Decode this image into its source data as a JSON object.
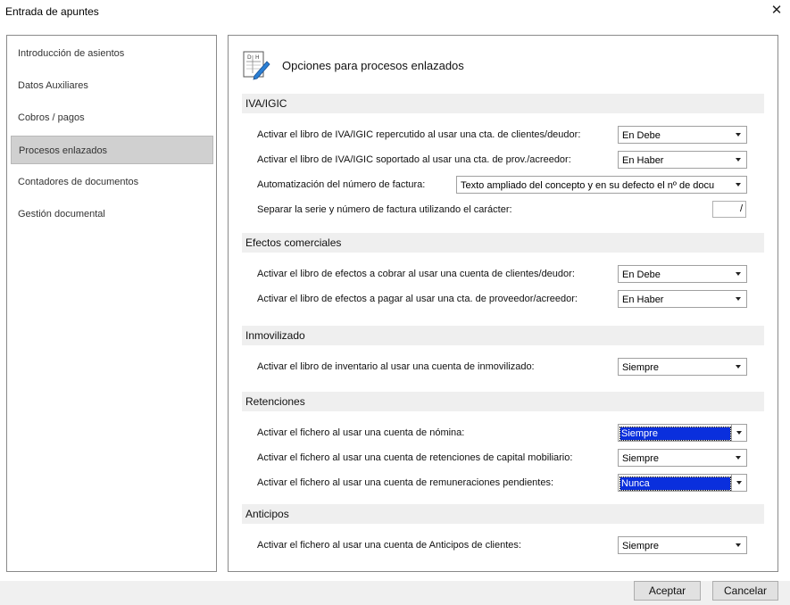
{
  "window": {
    "title": "Entrada de apuntes",
    "close_glyph": "✕"
  },
  "nav": {
    "items": [
      {
        "label": "Introducción de asientos"
      },
      {
        "label": "Datos Auxiliares"
      },
      {
        "label": "Cobros / pagos"
      },
      {
        "label": "Procesos enlazados",
        "selected": true
      },
      {
        "label": "Contadores de documentos"
      },
      {
        "label": "Gestión documental"
      }
    ]
  },
  "header": {
    "title": "Opciones para procesos enlazados",
    "icon": "document-edit-icon"
  },
  "sections": {
    "iva": {
      "title": "IVA/IGIC",
      "rows": [
        {
          "label": "Activar el libro de IVA/IGIC repercutido al usar una cta. de clientes/deudor:",
          "value": "En Debe"
        },
        {
          "label": "Activar el libro de IVA/IGIC soportado al usar una cta. de prov./acreedor:",
          "value": "En Haber"
        },
        {
          "label": "Automatización del número de factura:",
          "value": "Texto ampliado del concepto y en su defecto el nº de docu"
        },
        {
          "label": "Separar la serie y número de factura utilizando el carácter:",
          "value": "/"
        }
      ]
    },
    "efectos": {
      "title": "Efectos comerciales",
      "rows": [
        {
          "label": "Activar el libro de efectos a cobrar al usar una cuenta de clientes/deudor:",
          "value": "En Debe"
        },
        {
          "label": "Activar el libro de efectos a pagar al usar una cta. de proveedor/acreedor:",
          "value": "En Haber"
        }
      ]
    },
    "inmovilizado": {
      "title": "Inmovilizado",
      "rows": [
        {
          "label": "Activar el libro de inventario al usar una cuenta de inmovilizado:",
          "value": "Siempre"
        }
      ]
    },
    "retenciones": {
      "title": "Retenciones",
      "rows": [
        {
          "label": "Activar el fichero al usar una cuenta de nómina:",
          "value": "Siempre",
          "highlighted": true
        },
        {
          "label": "Activar el fichero al usar una cuenta de retenciones de capital mobiliario:",
          "value": "Siempre"
        },
        {
          "label": "Activar el fichero al usar una cuenta de remuneraciones pendientes:",
          "value": "Nunca",
          "highlighted": true
        }
      ]
    },
    "anticipos": {
      "title": "Anticipos",
      "rows": [
        {
          "label": "Activar el fichero al usar una cuenta de Anticipos de clientes:",
          "value": "Siempre"
        }
      ]
    }
  },
  "buttons": {
    "accept": "Aceptar",
    "cancel": "Cancelar"
  },
  "colors": {
    "selection": "#0a2fdd",
    "nav_selected": "#d0d0d0",
    "section_bg": "#efefef",
    "footer_bg": "#f0f0f0"
  }
}
